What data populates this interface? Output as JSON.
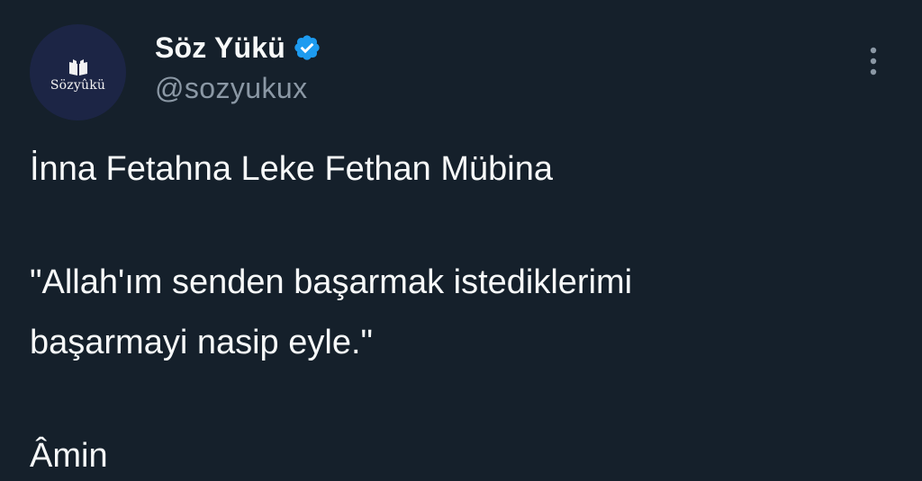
{
  "author": {
    "display_name": "Söz Yükü",
    "handle": "@sozyukux",
    "avatar_text": "Sözyûkü",
    "avatar_icon": "book-icon",
    "verified_icon": "verified-badge-icon",
    "verified_color": "#1d9bf0"
  },
  "menu": {
    "icon": "more-vertical-icon"
  },
  "tweet": {
    "lines": [
      "İnna Fetahna Leke Fethan Mübina",
      "\"Allah'ım senden başarmak istediklerimi",
      "başarmayi nasip eyle.\"",
      "Âmin"
    ]
  },
  "colors": {
    "background": "#15202b",
    "text_primary": "#f7f9f9",
    "text_secondary": "#8b98a5",
    "avatar_bg": "#1c2545"
  }
}
